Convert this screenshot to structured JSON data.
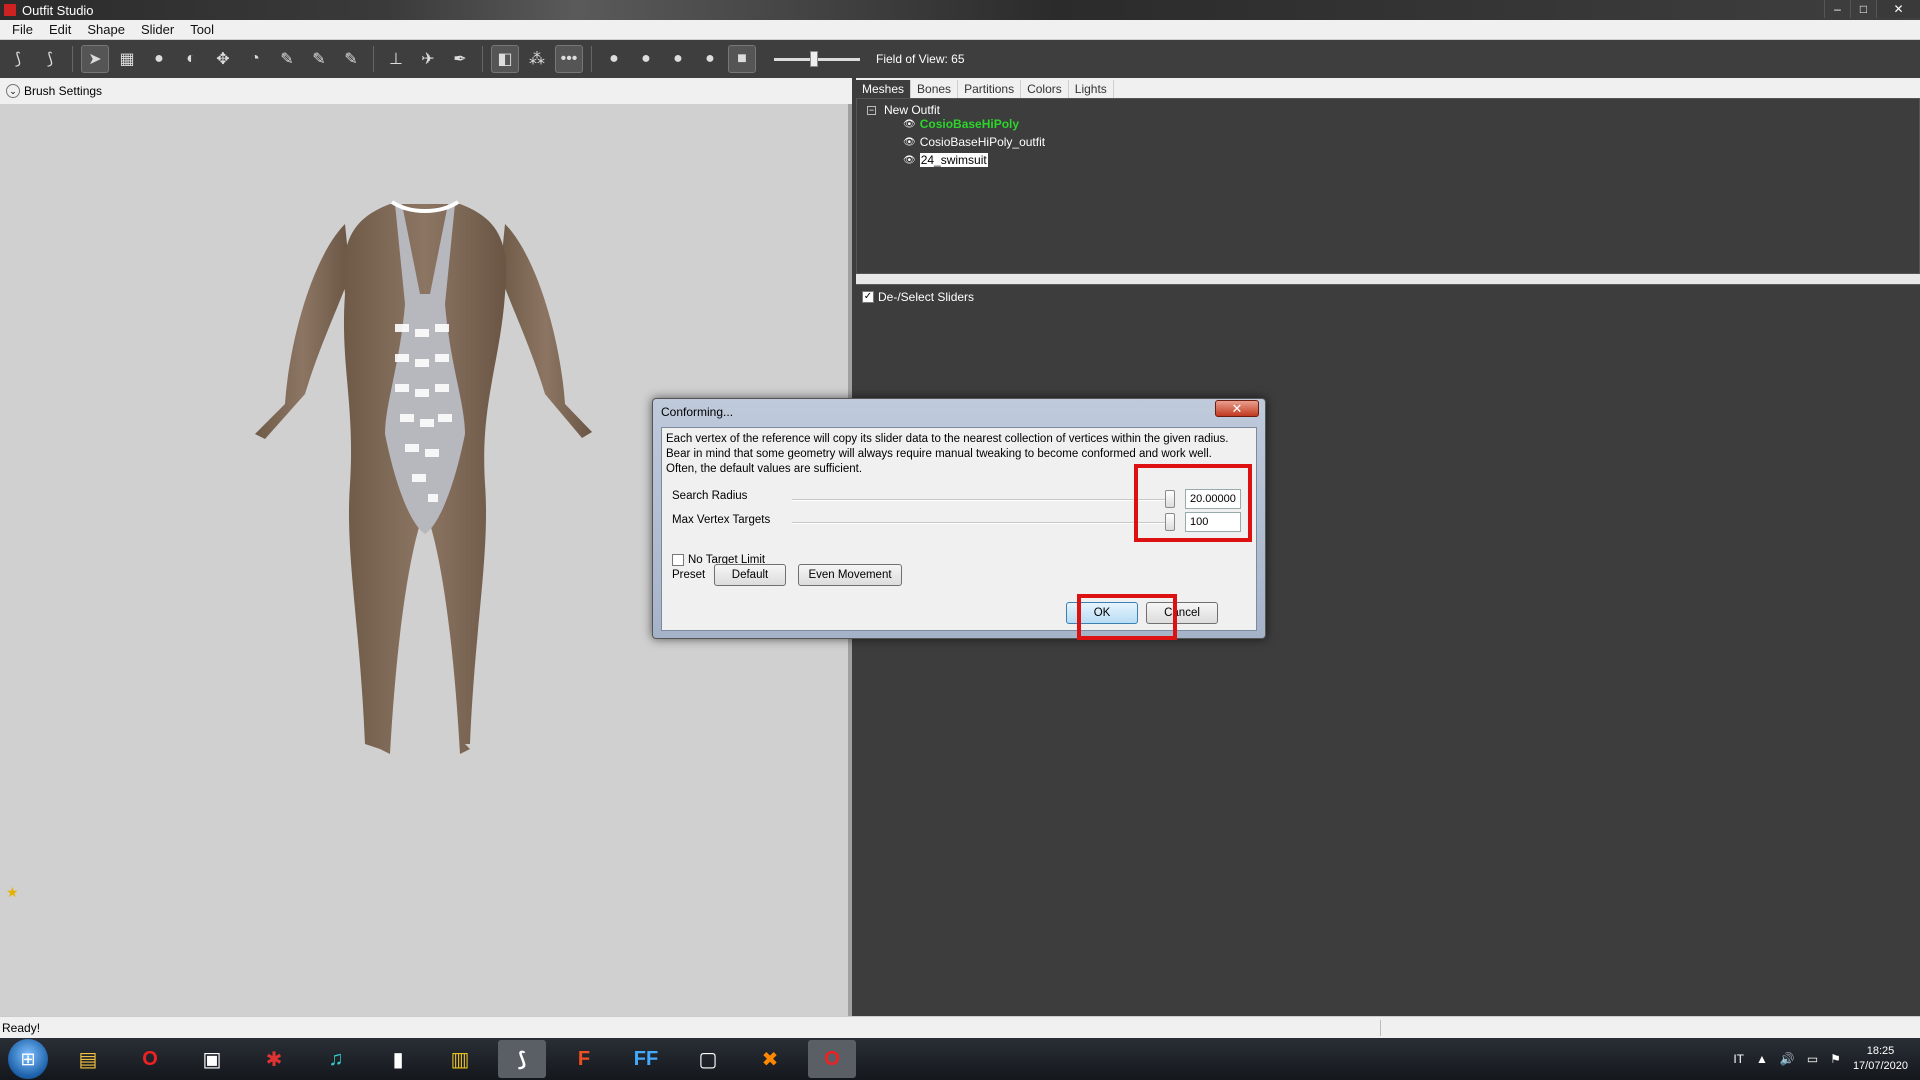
{
  "window": {
    "title": "Outfit Studio",
    "controls": {
      "minimize": "–",
      "maximize": "□",
      "close": "✕"
    }
  },
  "menu": [
    "File",
    "Edit",
    "Shape",
    "Slider",
    "Tool"
  ],
  "toolbar": {
    "fov_label": "Field of View: 65",
    "tools": [
      "select-icon",
      "transform-icon",
      "cursor-icon",
      "mask-icon",
      "inflate-icon",
      "deflate-icon",
      "move-icon",
      "smooth-icon",
      "undiff-icon",
      "weight-icon",
      "color-icon",
      "alpha-icon",
      "xform-icon",
      "pin-icon",
      "pen-icon",
      "mirror-icon",
      "connected-icon",
      "symmetry-icon",
      "dot-small-icon",
      "dot-medium-icon",
      "dot-large-icon",
      "dot-xl-icon",
      "cube-icon"
    ]
  },
  "brush_settings": {
    "label": "Brush Settings"
  },
  "right_panel": {
    "tabs": [
      "Meshes",
      "Bones",
      "Partitions",
      "Colors",
      "Lights"
    ],
    "active_tab": "Meshes",
    "tree": {
      "root": "New Outfit",
      "items": [
        {
          "label": "CosioBaseHiPoly",
          "state": "reference"
        },
        {
          "label": "CosioBaseHiPoly_outfit",
          "state": "normal"
        },
        {
          "label": "24_swimsuit",
          "state": "selected"
        }
      ]
    },
    "sliders_header": "De-/Select Sliders"
  },
  "dialog": {
    "title": "Conforming...",
    "description": "Each vertex of the reference will copy its slider data to the nearest collection of vertices within the given radius. Bear in mind that some geometry will always require manual tweaking to become conformed and work well. Often, the default values are sufficient.",
    "params": [
      {
        "label": "Search Radius",
        "value": "20.00000",
        "level": 0.97
      },
      {
        "label": "Max Vertex Targets",
        "value": "100",
        "level": 0.97
      }
    ],
    "no_target_limit": "No Target Limit",
    "preset_label": "Preset",
    "preset_buttons": [
      "Default",
      "Even Movement"
    ],
    "ok": "OK",
    "cancel": "Cancel",
    "highlight_color": "#dd1111"
  },
  "status": {
    "text": "Ready!"
  },
  "taskbar": {
    "apps": [
      "explorer-icon",
      "opera-icon",
      "media-icon",
      "tool-icon",
      "music-icon",
      "audio-icon",
      "folder-app-icon",
      "outfit-studio-icon",
      "f-app-icon",
      "ff-app-icon",
      "window-app-icon",
      "x-app-icon",
      "opera-red-icon"
    ],
    "lang": "IT",
    "time": "18:25",
    "date": "17/07/2020"
  }
}
